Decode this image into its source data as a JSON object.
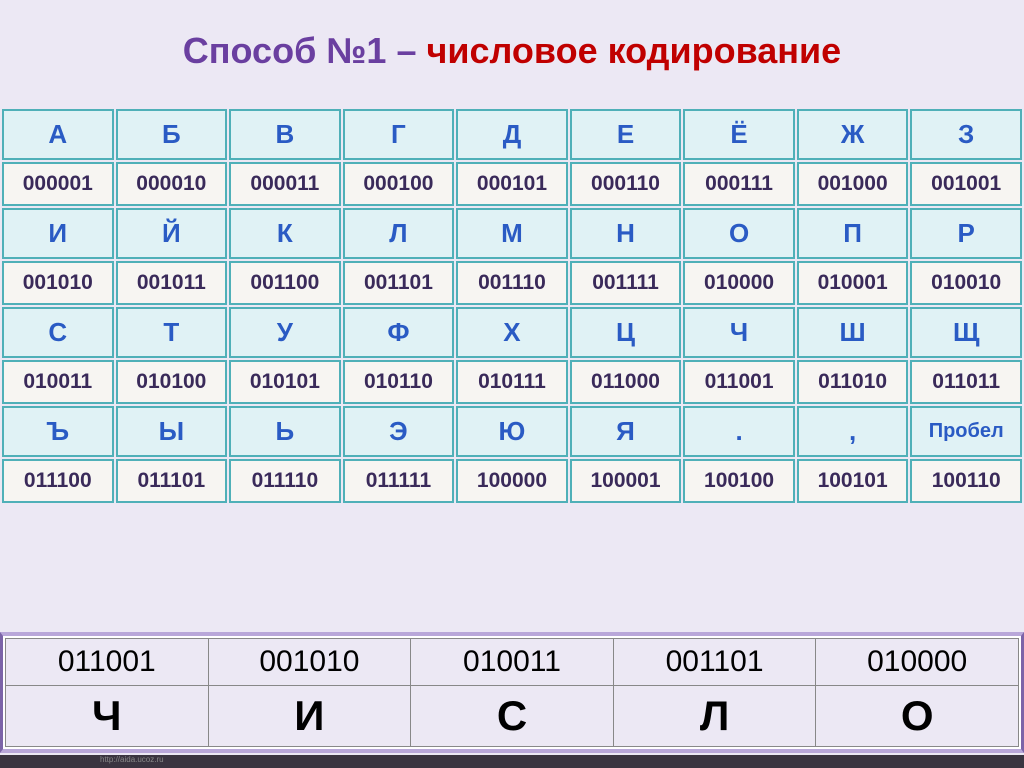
{
  "title": {
    "part1": "Способ №1 – ",
    "part2": "числовое кодирование"
  },
  "table": {
    "row0_letters": [
      "А",
      "Б",
      "В",
      "Г",
      "Д",
      "Е",
      "Ё",
      "Ж",
      "З"
    ],
    "row0_codes": [
      "000001",
      "000010",
      "000011",
      "000100",
      "000101",
      "000110",
      "000111",
      "001000",
      "001001"
    ],
    "row1_letters": [
      "И",
      "Й",
      "К",
      "Л",
      "М",
      "Н",
      "О",
      "П",
      "Р"
    ],
    "row1_codes": [
      "001010",
      "001011",
      "001100",
      "001101",
      "001110",
      "001111",
      "010000",
      "010001",
      "010010"
    ],
    "row2_letters": [
      "С",
      "Т",
      "У",
      "Ф",
      "Х",
      "Ц",
      "Ч",
      "Ш",
      "Щ"
    ],
    "row2_codes": [
      "010011",
      "010100",
      "010101",
      "010110",
      "010111",
      "011000",
      "011001",
      "011010",
      "011011"
    ],
    "row3_letters": [
      "Ъ",
      "Ы",
      "Ь",
      "Э",
      "Ю",
      "Я",
      ".",
      ",",
      "Пробел"
    ],
    "row3_codes": [
      "011100",
      "011101",
      "011110",
      "011111",
      "100000",
      "100001",
      "100100",
      "100101",
      "100110"
    ]
  },
  "example": {
    "codes": [
      "011001",
      "001010",
      "010011",
      "001101",
      "010000"
    ],
    "letters": [
      "Ч",
      "И",
      "С",
      "Л",
      "О"
    ]
  },
  "footer": "http://aida.ucoz.ru"
}
